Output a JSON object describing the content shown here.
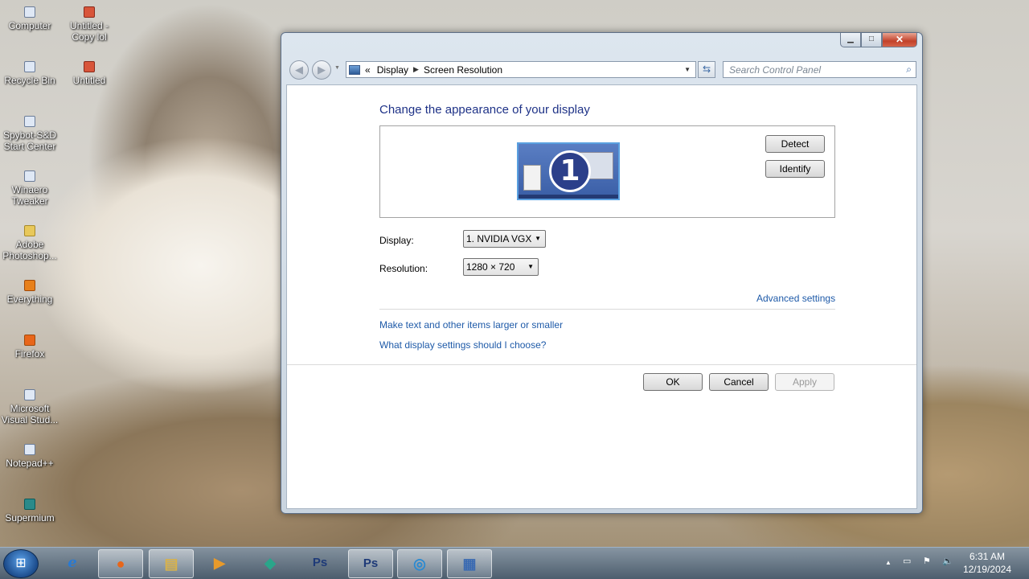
{
  "desktop": {
    "icons": [
      {
        "label": "Computer"
      },
      {
        "label": "Untitled - Copy lol"
      },
      {
        "label": "Recycle Bin"
      },
      {
        "label": "Untitled"
      },
      {
        "label": "Spybot-S&D Start Center"
      },
      {
        "label": "Winaero Tweaker"
      },
      {
        "label": "Adobe Photoshop..."
      },
      {
        "label": "Everything"
      },
      {
        "label": "Firefox"
      },
      {
        "label": "Microsoft Visual Stud..."
      },
      {
        "label": "Notepad++"
      },
      {
        "label": "Supermium"
      }
    ]
  },
  "window": {
    "caption": {
      "minimize": "▁",
      "maximize": "□",
      "close": "✕"
    },
    "nav": {
      "back": "◀",
      "forward": "▶"
    },
    "address": {
      "prefix": "«",
      "crumb1": "Display",
      "separator": "▶",
      "crumb2": "Screen Resolution",
      "dropdown": "▼"
    },
    "refresh": "⇆",
    "search": {
      "placeholder": "Search Control Panel",
      "icon": "⌕"
    },
    "heading": "Change the appearance of your display",
    "monitor_number": "1",
    "detect_label": "Detect",
    "identify_label": "Identify",
    "display_label": "Display:",
    "display_value": "1. NVIDIA VGX",
    "resolution_label": "Resolution:",
    "resolution_value": "1280 × 720",
    "advanced_link": "Advanced settings",
    "link_text_size": "Make text and other items larger or smaller",
    "link_which_settings": "What display settings should I choose?",
    "ok_label": "OK",
    "cancel_label": "Cancel",
    "apply_label": "Apply"
  },
  "taskbar": {
    "start_glyph": "⊞",
    "apps": [
      {
        "name": "internet-explorer",
        "glyph": "e",
        "color": "#2a7ad2"
      },
      {
        "name": "firefox",
        "glyph": "●",
        "color": "#e8661a"
      },
      {
        "name": "file-explorer",
        "glyph": "▤",
        "color": "#d9b24a"
      },
      {
        "name": "media-player",
        "glyph": "▶",
        "color": "#e89a2a"
      },
      {
        "name": "app-teal",
        "glyph": "◆",
        "color": "#2aa58a"
      },
      {
        "name": "photoshop-admin",
        "glyph": "Ps",
        "color": "#1e3a78"
      },
      {
        "name": "photoshop",
        "glyph": "Ps",
        "color": "#1e3a78"
      },
      {
        "name": "supermium",
        "glyph": "◎",
        "color": "#2a8ad2"
      },
      {
        "name": "control-panel",
        "glyph": "▦",
        "color": "#3a6ab2"
      }
    ],
    "tray": {
      "show_hidden": "▲",
      "network": "▭",
      "flag": "⚑",
      "volume": "🔈"
    },
    "time": "6:31 AM",
    "date": "12/19/2024"
  }
}
